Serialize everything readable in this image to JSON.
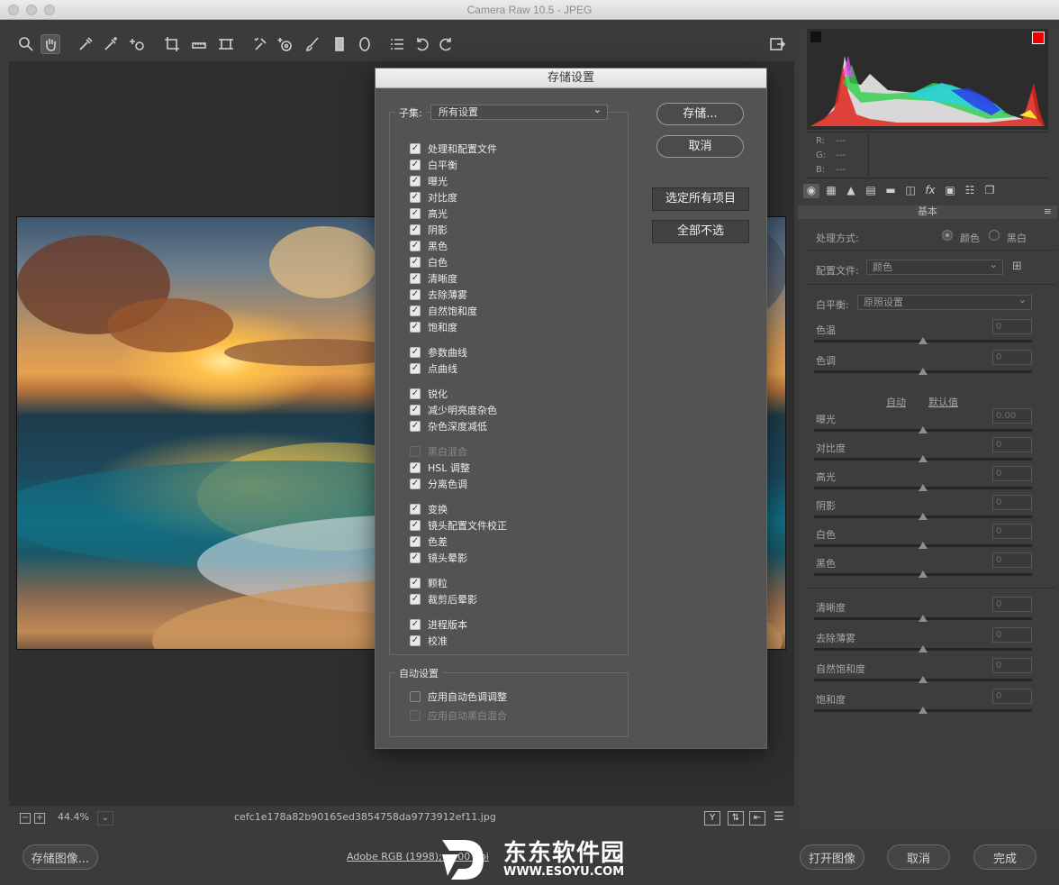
{
  "window": {
    "title": "Camera Raw 10.5 -  JPEG"
  },
  "toolbar": {
    "tools": [
      "zoom-icon",
      "hand-icon",
      "white-balance-icon",
      "color-sampler-icon",
      "targeted-adjust-icon",
      "crop-icon",
      "straighten-icon",
      "transform-icon",
      "spot-removal-icon",
      "red-eye-icon",
      "adjustment-brush-icon",
      "graduated-filter-icon",
      "radial-filter-icon",
      "presets-list-icon",
      "rotate-left-icon",
      "rotate-right-icon"
    ],
    "right_tool": "open-in-photoshop-icon"
  },
  "status": {
    "zoom": "44.4%",
    "filename": "cefc1e178a82b90165ed3854758da9773912ef11.jpg",
    "minus": "−",
    "plus": "+"
  },
  "bottom": {
    "save_image": "存储图像...",
    "workflow": "Adobe RGB (1998); ... 00 ppi",
    "open_image": "打开图像",
    "cancel": "取消",
    "done": "完成"
  },
  "histogram": {
    "r_label": "R:",
    "g_label": "G:",
    "b_label": "B:",
    "r_val": "---",
    "g_val": "---",
    "b_val": "---"
  },
  "basic": {
    "header": "基本",
    "treatment_label": "处理方式:",
    "treatment_color": "颜色",
    "treatment_bw": "黑白",
    "profile_label": "配置文件:",
    "profile_value": "颜色",
    "wb_label": "白平衡:",
    "wb_value": "原照设置",
    "temp_label": "色温",
    "temp_val": "0",
    "tint_label": "色调",
    "tint_val": "0",
    "auto": "自动",
    "default": "默认值",
    "exposure_label": "曝光",
    "exposure_val": "0.00",
    "contrast_label": "对比度",
    "contrast_val": "0",
    "highlights_label": "高光",
    "highlights_val": "0",
    "shadows_label": "阴影",
    "shadows_val": "0",
    "whites_label": "白色",
    "whites_val": "0",
    "blacks_label": "黑色",
    "blacks_val": "0",
    "clarity_label": "清晰度",
    "clarity_val": "0",
    "dehaze_label": "去除薄雾",
    "dehaze_val": "0",
    "vibrance_label": "自然饱和度",
    "vibrance_val": "0",
    "saturation_label": "饱和度",
    "saturation_val": "0"
  },
  "dialog": {
    "title": "存储设置",
    "subset_label": "子集:",
    "subset_value": "所有设置",
    "items": [
      {
        "label": "处理和配置文件",
        "state": "on"
      },
      {
        "label": "白平衡",
        "state": "on"
      },
      {
        "label": "曝光",
        "state": "on"
      },
      {
        "label": "对比度",
        "state": "on"
      },
      {
        "label": "高光",
        "state": "on"
      },
      {
        "label": "阴影",
        "state": "on"
      },
      {
        "label": "黑色",
        "state": "on"
      },
      {
        "label": "白色",
        "state": "on"
      },
      {
        "label": "清晰度",
        "state": "on"
      },
      {
        "label": "去除薄雾",
        "state": "on"
      },
      {
        "label": "自然饱和度",
        "state": "on"
      },
      {
        "label": "饱和度",
        "state": "on"
      },
      {
        "label": "参数曲线",
        "state": "on"
      },
      {
        "label": "点曲线",
        "state": "on"
      },
      {
        "label": "锐化",
        "state": "on"
      },
      {
        "label": "减少明亮度杂色",
        "state": "on"
      },
      {
        "label": "杂色深度减低",
        "state": "on"
      },
      {
        "label": "黑白混合",
        "state": "disabled"
      },
      {
        "label": "HSL 调整",
        "state": "on"
      },
      {
        "label": "分离色调",
        "state": "on"
      },
      {
        "label": "变换",
        "state": "on"
      },
      {
        "label": "镜头配置文件校正",
        "state": "on"
      },
      {
        "label": "色差",
        "state": "on"
      },
      {
        "label": "镜头晕影",
        "state": "on"
      },
      {
        "label": "颗粒",
        "state": "on"
      },
      {
        "label": "裁剪后晕影",
        "state": "on"
      },
      {
        "label": "进程版本",
        "state": "on"
      },
      {
        "label": "校准",
        "state": "on"
      }
    ],
    "auto_group": "自动设置",
    "auto_items": [
      {
        "label": "应用自动色调调整",
        "state": "off"
      },
      {
        "label": "应用自动黑白混合",
        "state": "disabled"
      }
    ],
    "save": "存储...",
    "cancel": "取消",
    "select_all": "选定所有项目",
    "select_none": "全部不选"
  },
  "watermark": {
    "name": "东东软件园",
    "url": "WWW.ESOYU.COM"
  }
}
